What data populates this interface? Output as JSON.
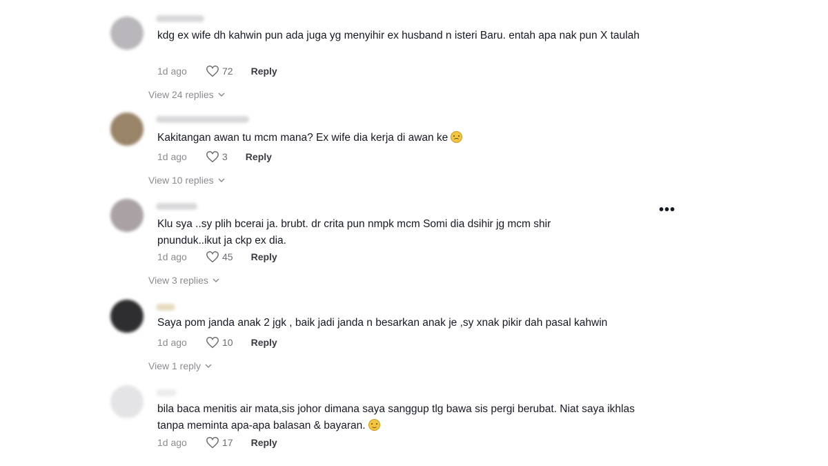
{
  "comments": [
    {
      "text": "kdg ex wife dh kahwin pun ada juga yg menyihir ex husband n isteri Baru. entah apa nak pun X taulah",
      "time": "1d ago",
      "likes": "72",
      "reply_label": "Reply",
      "view_replies": "View 24 replies",
      "avatar_color": "#b9b7bb"
    },
    {
      "text": "Kakitangan awan tu mcm mana? Ex wife dia kerja di awan ke",
      "time": "1d ago",
      "likes": "3",
      "reply_label": "Reply",
      "view_replies": "View 10 replies",
      "avatar_color": "#9a8468"
    },
    {
      "text": "Klu sya ..sy plih bcerai ja. brubt. dr crita pun nmpk mcm Somi dia dsihir jg mcm shir pnunduk..ikut ja ckp ex dia.",
      "time": "1d ago",
      "likes": "45",
      "reply_label": "Reply",
      "view_replies": "View 3 replies",
      "avatar_color": "#a9a1a4"
    },
    {
      "text": "Saya pom janda anak 2 jgk , baik jadi janda n besarkan anak je ,sy xnak pikir dah pasal kahwin",
      "time": "1d ago",
      "likes": "10",
      "reply_label": "Reply",
      "view_replies": "View 1 reply",
      "avatar_color": "#2e2e30"
    },
    {
      "text": "bila baca menitis air mata,sis johor dimana saya sanggup tlg bawa sis pergi berubat. Niat saya ikhlas tanpa meminta apa-apa balasan & bayaran.",
      "time": "1d ago",
      "likes": "17",
      "reply_label": "Reply",
      "avatar_color": "#e4e4e6"
    }
  ],
  "more_menu": "•••",
  "icons": {
    "like": "heart-outline-icon",
    "expand": "chevron-down-icon",
    "emoji_2": "sad-face-emoji-icon",
    "emoji_5": "smiling-face-emoji-icon"
  },
  "colors": {
    "text": "#161823",
    "muted": "#8a8b91",
    "reply": "#3a3b42"
  }
}
